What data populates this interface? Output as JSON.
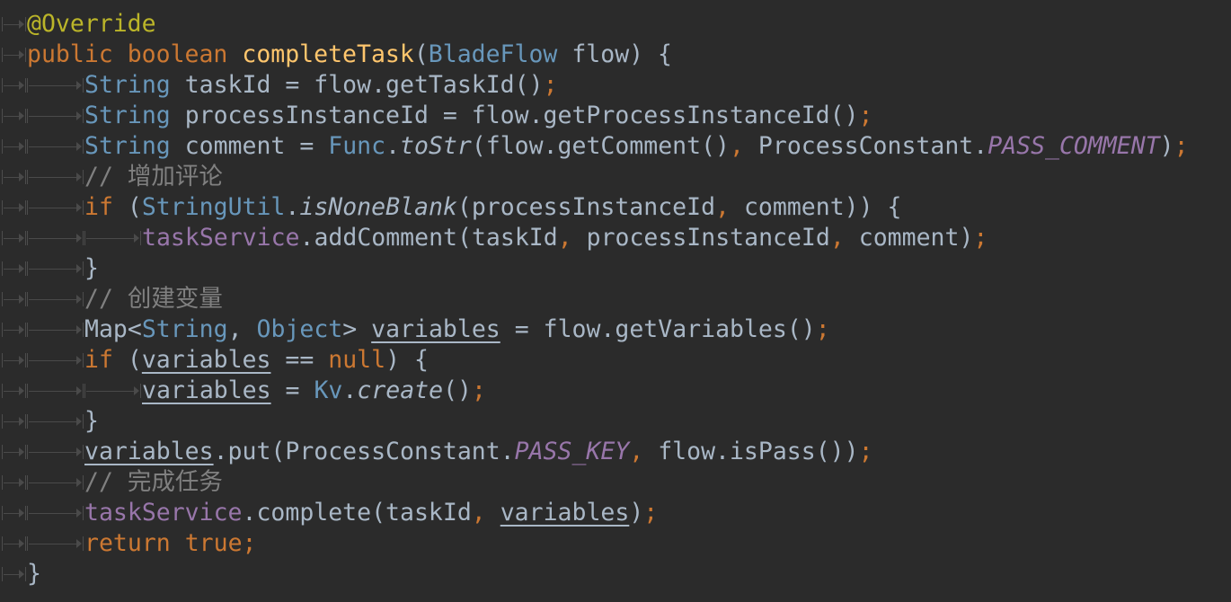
{
  "editor": {
    "colors": {
      "background": "#2b2b2b",
      "default": "#a9b7c6",
      "keyword": "#cc7832",
      "annotation": "#bbb529",
      "method_decl": "#ffc66d",
      "type": "#6897bb",
      "field": "#9876aa",
      "comment": "#808080"
    },
    "lines": [
      {
        "indent": 0,
        "tokens": [
          {
            "t": "@Override",
            "c": "ann"
          }
        ]
      },
      {
        "indent": 0,
        "tokens": [
          {
            "t": "public",
            "c": "kw"
          },
          {
            "t": " "
          },
          {
            "t": "boolean",
            "c": "kw"
          },
          {
            "t": " "
          },
          {
            "t": "completeTask",
            "c": "fn"
          },
          {
            "t": "("
          },
          {
            "t": "BladeFlow",
            "c": "type"
          },
          {
            "t": " flow) {"
          }
        ]
      },
      {
        "indent": 1,
        "tokens": [
          {
            "t": "String",
            "c": "type"
          },
          {
            "t": " taskId = flow.getTaskId()"
          },
          {
            "t": ";",
            "c": "kw"
          }
        ]
      },
      {
        "indent": 1,
        "tokens": [
          {
            "t": "String",
            "c": "type"
          },
          {
            "t": " processInstanceId = flow.getProcessInstanceId()"
          },
          {
            "t": ";",
            "c": "kw"
          }
        ]
      },
      {
        "indent": 1,
        "tokens": [
          {
            "t": "String",
            "c": "type"
          },
          {
            "t": " comment = "
          },
          {
            "t": "Func",
            "c": "type"
          },
          {
            "t": "."
          },
          {
            "t": "toStr",
            "c": "ital"
          },
          {
            "t": "(flow.getComment()"
          },
          {
            "t": ",",
            "c": "kw"
          },
          {
            "t": " ProcessConstant."
          },
          {
            "t": "PASS_COMMENT",
            "c": "cst"
          },
          {
            "t": ")"
          },
          {
            "t": ";",
            "c": "kw"
          }
        ]
      },
      {
        "indent": 1,
        "tokens": [
          {
            "t": "// 增加评论",
            "c": "cm"
          }
        ]
      },
      {
        "indent": 1,
        "tokens": [
          {
            "t": "if",
            "c": "kw"
          },
          {
            "t": " ("
          },
          {
            "t": "StringUtil",
            "c": "type"
          },
          {
            "t": "."
          },
          {
            "t": "isNoneBlank",
            "c": "ital"
          },
          {
            "t": "(processInstanceId"
          },
          {
            "t": ",",
            "c": "kw"
          },
          {
            "t": " comment)) {"
          }
        ]
      },
      {
        "indent": 2,
        "tokens": [
          {
            "t": "taskService",
            "c": "fld"
          },
          {
            "t": ".addComment(taskId"
          },
          {
            "t": ",",
            "c": "kw"
          },
          {
            "t": " processInstanceId"
          },
          {
            "t": ",",
            "c": "kw"
          },
          {
            "t": " comment)"
          },
          {
            "t": ";",
            "c": "kw"
          }
        ]
      },
      {
        "indent": 1,
        "tokens": [
          {
            "t": "}"
          }
        ]
      },
      {
        "indent": 1,
        "tokens": [
          {
            "t": "// 创建变量",
            "c": "cm"
          }
        ]
      },
      {
        "indent": 1,
        "tokens": [
          {
            "t": "Map<"
          },
          {
            "t": "String",
            "c": "type"
          },
          {
            "t": ","
          },
          {
            "t": " "
          },
          {
            "t": "Object",
            "c": "type"
          },
          {
            "t": "> "
          },
          {
            "t": "variables",
            "c": "und"
          },
          {
            "t": " = flow.getVariables()"
          },
          {
            "t": ";",
            "c": "kw"
          }
        ]
      },
      {
        "indent": 1,
        "tokens": [
          {
            "t": "if",
            "c": "kw"
          },
          {
            "t": " ("
          },
          {
            "t": "variables",
            "c": "und"
          },
          {
            "t": " == "
          },
          {
            "t": "null",
            "c": "kw"
          },
          {
            "t": ") {"
          }
        ]
      },
      {
        "indent": 2,
        "tokens": [
          {
            "t": "variables",
            "c": "und"
          },
          {
            "t": " = "
          },
          {
            "t": "Kv",
            "c": "type"
          },
          {
            "t": "."
          },
          {
            "t": "create",
            "c": "ital"
          },
          {
            "t": "()"
          },
          {
            "t": ";",
            "c": "kw"
          }
        ]
      },
      {
        "indent": 1,
        "tokens": [
          {
            "t": "}"
          }
        ]
      },
      {
        "indent": 1,
        "tokens": [
          {
            "t": "variables",
            "c": "und"
          },
          {
            "t": ".put(ProcessConstant."
          },
          {
            "t": "PASS_KEY",
            "c": "cst"
          },
          {
            "t": ",",
            "c": "kw"
          },
          {
            "t": " flow.isPass())"
          },
          {
            "t": ";",
            "c": "kw"
          }
        ]
      },
      {
        "indent": 1,
        "tokens": [
          {
            "t": "// 完成任务",
            "c": "cm"
          }
        ]
      },
      {
        "indent": 1,
        "tokens": [
          {
            "t": "taskService",
            "c": "fld"
          },
          {
            "t": ".complete(taskId"
          },
          {
            "t": ",",
            "c": "kw"
          },
          {
            "t": " "
          },
          {
            "t": "variables",
            "c": "und"
          },
          {
            "t": ")"
          },
          {
            "t": ";",
            "c": "kw"
          }
        ]
      },
      {
        "indent": 1,
        "tokens": [
          {
            "t": "return",
            "c": "kw"
          },
          {
            "t": " "
          },
          {
            "t": "true",
            "c": "kw"
          },
          {
            "t": ";",
            "c": "kw"
          }
        ]
      },
      {
        "indent": 0,
        "tokens": [
          {
            "t": "}"
          }
        ]
      }
    ]
  }
}
